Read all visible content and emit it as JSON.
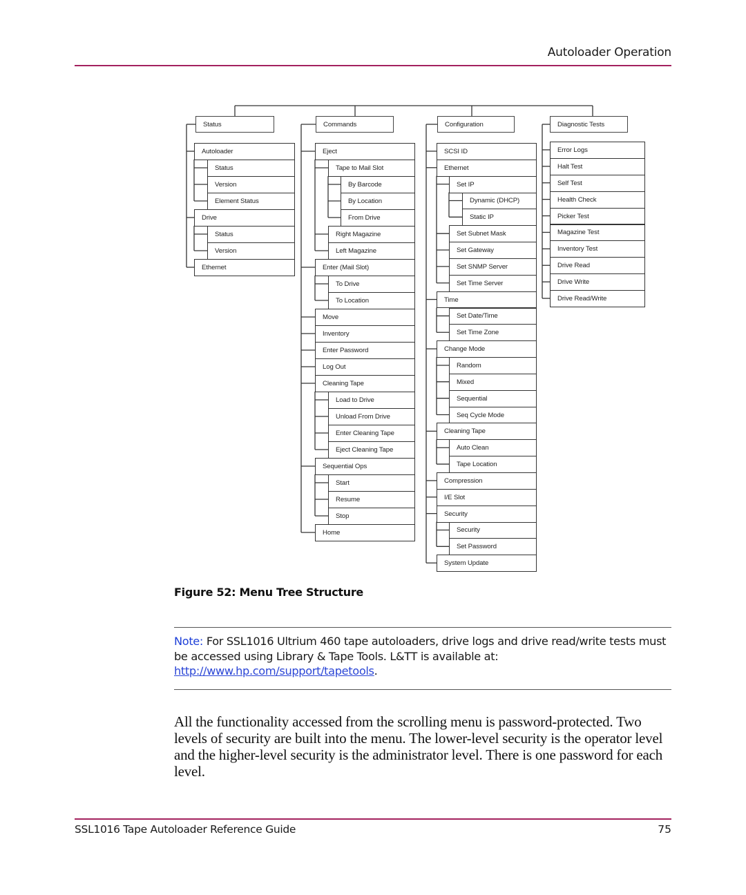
{
  "header": {
    "section_title": "Autoloader Operation"
  },
  "figure": {
    "caption": "Figure 52:  Menu Tree Structure",
    "menu_tree": [
      {
        "label": "Status",
        "children": [
          {
            "label": "Autoloader",
            "children": [
              {
                "label": "Status"
              },
              {
                "label": "Version"
              },
              {
                "label": "Element Status"
              }
            ]
          },
          {
            "label": "Drive",
            "children": [
              {
                "label": "Status"
              },
              {
                "label": "Version"
              }
            ]
          },
          {
            "label": "Ethernet"
          }
        ]
      },
      {
        "label": "Commands",
        "children": [
          {
            "label": "Eject",
            "children": [
              {
                "label": "Tape to Mail Slot",
                "children": [
                  {
                    "label": "By Barcode"
                  },
                  {
                    "label": "By Location"
                  },
                  {
                    "label": "From Drive"
                  }
                ]
              },
              {
                "label": "Right Magazine"
              },
              {
                "label": "Left Magazine"
              }
            ]
          },
          {
            "label": "Enter (Mail Slot)",
            "children": [
              {
                "label": "To Drive"
              },
              {
                "label": "To Location"
              }
            ]
          },
          {
            "label": "Move"
          },
          {
            "label": "Inventory"
          },
          {
            "label": "Enter Password"
          },
          {
            "label": "Log Out"
          },
          {
            "label": "Cleaning Tape",
            "children": [
              {
                "label": "Load to Drive"
              },
              {
                "label": "Unload From Drive"
              },
              {
                "label": "Enter Cleaning Tape"
              },
              {
                "label": "Eject Cleaning Tape"
              }
            ]
          },
          {
            "label": "Sequential Ops",
            "children": [
              {
                "label": "Start"
              },
              {
                "label": "Resume"
              },
              {
                "label": "Stop"
              }
            ]
          },
          {
            "label": "Home"
          }
        ]
      },
      {
        "label": "Configuration",
        "children": [
          {
            "label": "SCSI ID"
          },
          {
            "label": "Ethernet",
            "children": [
              {
                "label": "Set IP",
                "children": [
                  {
                    "label": "Dynamic (DHCP)"
                  },
                  {
                    "label": "Static IP"
                  }
                ]
              },
              {
                "label": "Set Subnet Mask"
              },
              {
                "label": "Set Gateway"
              },
              {
                "label": "Set SNMP Server"
              },
              {
                "label": "Set Time Server"
              }
            ]
          },
          {
            "label": "Time",
            "children": [
              {
                "label": "Set Date/Time"
              },
              {
                "label": "Set Time Zone"
              }
            ]
          },
          {
            "label": "Change Mode",
            "children": [
              {
                "label": "Random"
              },
              {
                "label": "Mixed"
              },
              {
                "label": "Sequential"
              },
              {
                "label": "Seq Cycle Mode"
              }
            ]
          },
          {
            "label": "Cleaning Tape",
            "children": [
              {
                "label": "Auto Clean"
              },
              {
                "label": "Tape Location"
              }
            ]
          },
          {
            "label": "Compression"
          },
          {
            "label": "I/E Slot"
          },
          {
            "label": "Security",
            "children": [
              {
                "label": "Security"
              },
              {
                "label": "Set Password"
              }
            ]
          },
          {
            "label": "System Update"
          }
        ]
      },
      {
        "label": "Diagnostic Tests",
        "children": [
          {
            "label": "Error Logs"
          },
          {
            "label": "Halt Test"
          },
          {
            "label": "Self Test"
          },
          {
            "label": "Health Check"
          },
          {
            "label": "Picker Test"
          },
          {
            "label": "Magazine Test"
          },
          {
            "label": "Inventory Test"
          },
          {
            "label": "Drive Read"
          },
          {
            "label": "Drive Write"
          },
          {
            "label": "Drive Read/Write"
          }
        ]
      }
    ]
  },
  "note": {
    "label": "Note:",
    "text": " For SSL1016 Ultrium 460 tape autoloaders, drive logs and drive read/write tests must be accessed using Library & Tape Tools. L&TT is available at: ",
    "link_text": "http://www.hp.com/support/tapetools",
    "trailing": "."
  },
  "body": {
    "paragraph": "All the functionality accessed from the scrolling menu is password-protected. Two levels of security are built into the menu. The lower-level security is the operator level and the higher-level security is the administrator level. There is one password for each level."
  },
  "footer": {
    "guide_title": "SSL1016 Tape Autoloader Reference Guide",
    "page_number": "75"
  },
  "colors": {
    "accent_rule": "#a3215e",
    "note_label": "#1d3fd8",
    "link": "#2b46d6"
  }
}
